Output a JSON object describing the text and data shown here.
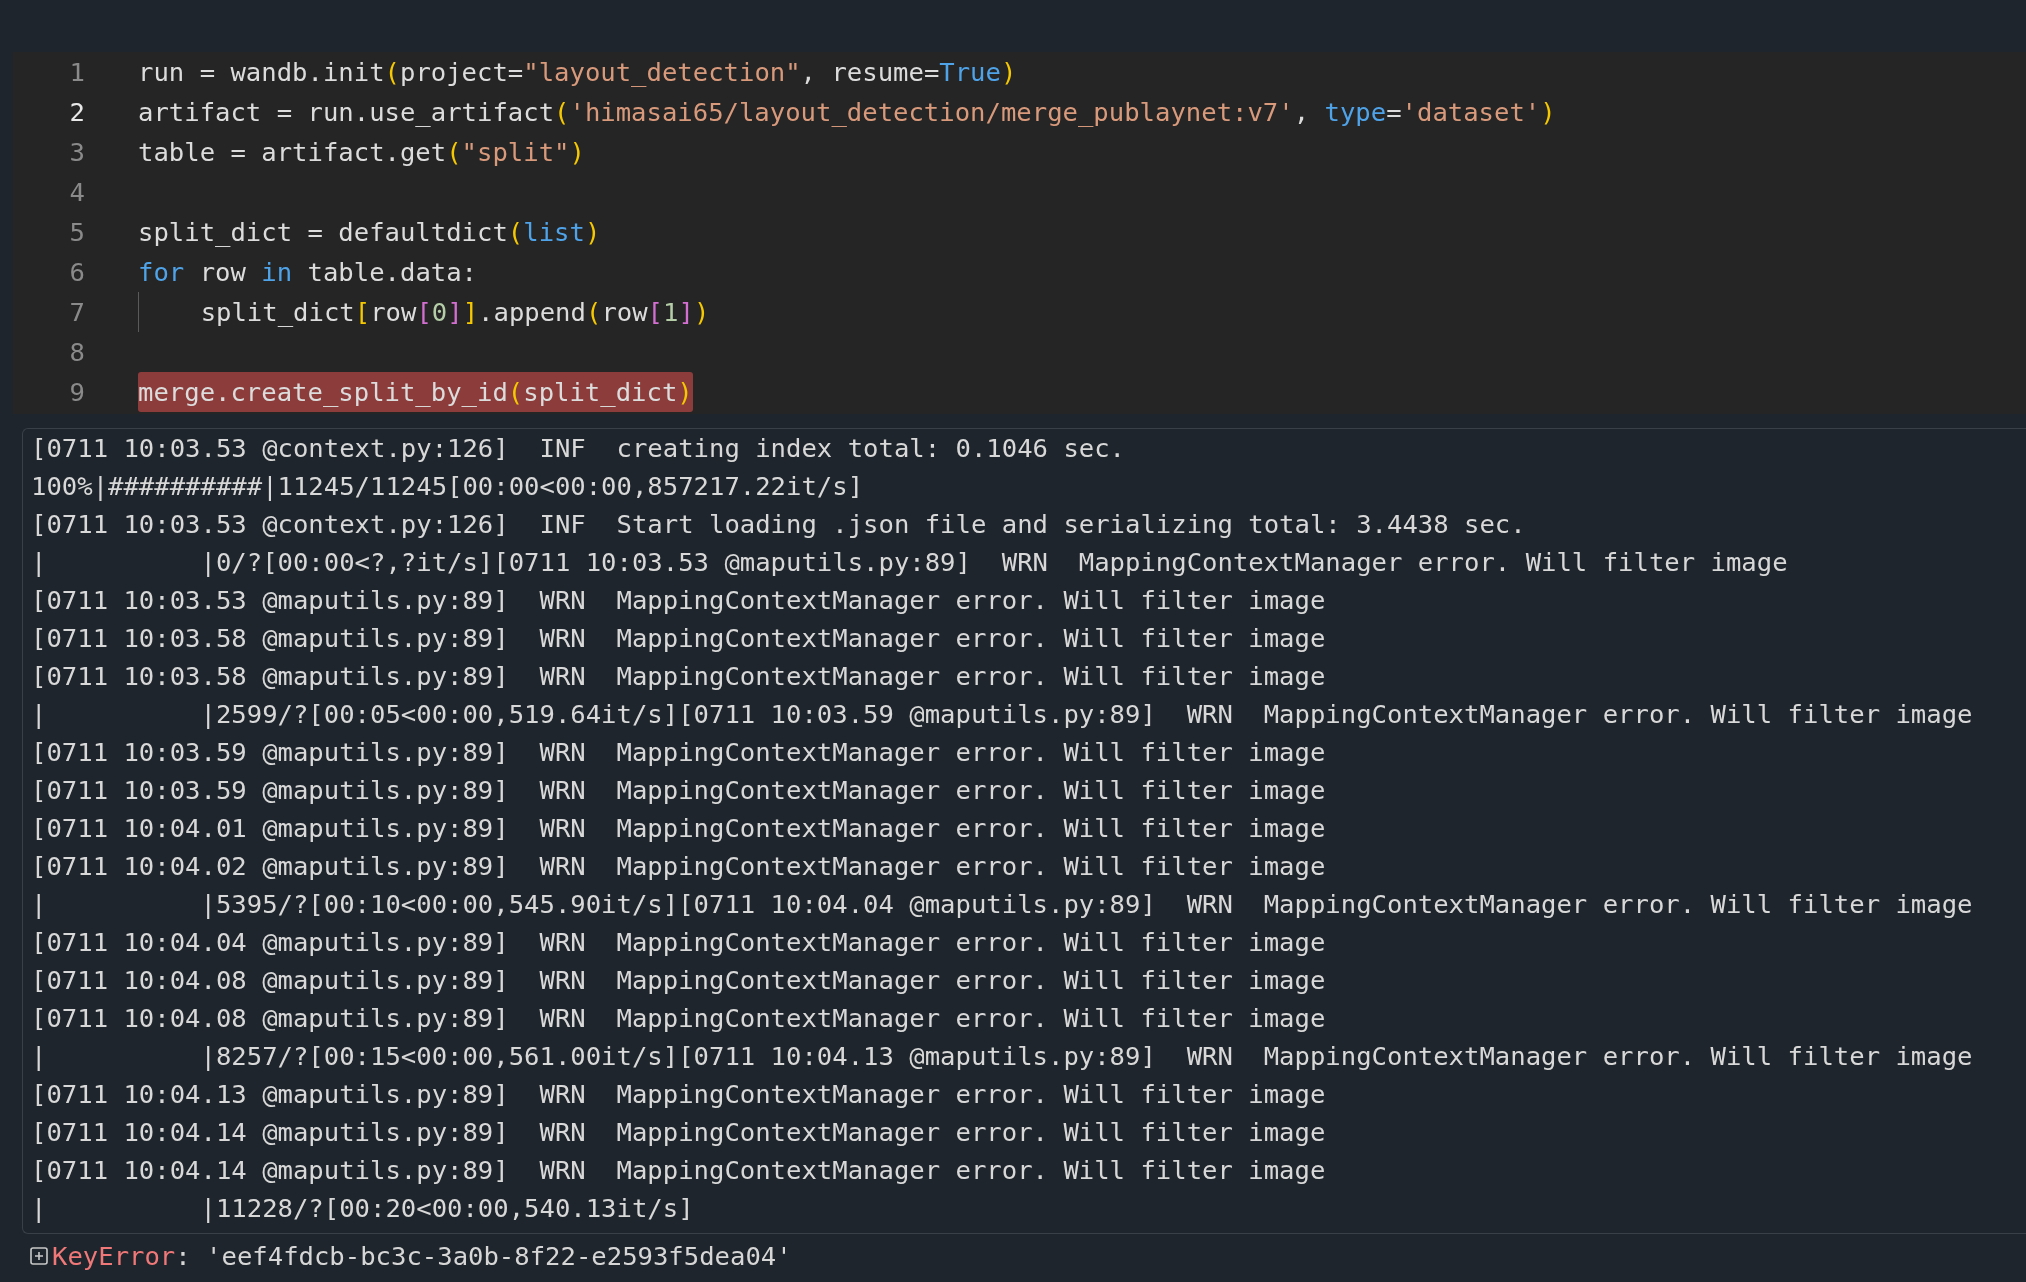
{
  "code_cell": {
    "lines": [
      {
        "number": "1",
        "active": false,
        "error": false,
        "tokens": [
          {
            "kind": "plain",
            "text": "run = wandb.init"
          },
          {
            "kind": "bracket",
            "text": "("
          },
          {
            "kind": "plain",
            "text": "project="
          },
          {
            "kind": "string",
            "text": "\"layout_detection\""
          },
          {
            "kind": "plain",
            "text": ", resume="
          },
          {
            "kind": "keyword",
            "text": "True"
          },
          {
            "kind": "bracket",
            "text": ")"
          }
        ]
      },
      {
        "number": "2",
        "active": true,
        "error": false,
        "tokens": [
          {
            "kind": "plain",
            "text": "artifact = run.use_artifact"
          },
          {
            "kind": "bracket",
            "text": "("
          },
          {
            "kind": "string",
            "text": "'himasai65/layout_detection/merge_publaynet:v7'"
          },
          {
            "kind": "plain",
            "text": ", "
          },
          {
            "kind": "keyword",
            "text": "type"
          },
          {
            "kind": "plain",
            "text": "="
          },
          {
            "kind": "string",
            "text": "'dataset'"
          },
          {
            "kind": "bracket",
            "text": ")"
          }
        ]
      },
      {
        "number": "3",
        "active": false,
        "error": false,
        "tokens": [
          {
            "kind": "plain",
            "text": "table = artifact.get"
          },
          {
            "kind": "bracket",
            "text": "("
          },
          {
            "kind": "string",
            "text": "\"split\""
          },
          {
            "kind": "bracket",
            "text": ")"
          }
        ]
      },
      {
        "number": "4",
        "active": false
      },
      {
        "number": "5",
        "active": false,
        "error": false,
        "tokens": [
          {
            "kind": "plain",
            "text": "split_dict = defaultdict"
          },
          {
            "kind": "bracket",
            "text": "("
          },
          {
            "kind": "keyword",
            "text": "list"
          },
          {
            "kind": "bracket",
            "text": ")"
          }
        ]
      },
      {
        "number": "6",
        "active": false,
        "error": false,
        "tokens": [
          {
            "kind": "keyword",
            "text": "for"
          },
          {
            "kind": "plain",
            "text": " row "
          },
          {
            "kind": "keyword",
            "text": "in"
          },
          {
            "kind": "plain",
            "text": " table.data:"
          }
        ]
      },
      {
        "number": "7",
        "active": false,
        "error": false,
        "indent_guide": true,
        "tokens": [
          {
            "kind": "plain",
            "text": "    split_dict"
          },
          {
            "kind": "bracket",
            "text": "["
          },
          {
            "kind": "plain",
            "text": "row"
          },
          {
            "kind": "bracket2",
            "text": "["
          },
          {
            "kind": "number",
            "text": "0"
          },
          {
            "kind": "bracket2",
            "text": "]"
          },
          {
            "kind": "bracket",
            "text": "]"
          },
          {
            "kind": "plain",
            "text": ".append"
          },
          {
            "kind": "bracket",
            "text": "("
          },
          {
            "kind": "plain",
            "text": "row"
          },
          {
            "kind": "bracket2",
            "text": "["
          },
          {
            "kind": "number",
            "text": "1"
          },
          {
            "kind": "bracket2",
            "text": "]"
          },
          {
            "kind": "bracket",
            "text": ")"
          }
        ]
      },
      {
        "number": "8",
        "active": false
      },
      {
        "number": "9",
        "active": false,
        "error": true,
        "tokens": [
          {
            "kind": "plain",
            "text": "merge.create_split_by_id"
          },
          {
            "kind": "bracket",
            "text": "("
          },
          {
            "kind": "plain",
            "text": "split_dict"
          },
          {
            "kind": "bracket",
            "text": ")"
          }
        ]
      }
    ]
  },
  "output": {
    "lines": [
      "[0711 10:03.53 @context.py:126]  INF  creating index total: 0.1046 sec.",
      "100%|##########|11245/11245[00:00<00:00,857217.22it/s]",
      "[0711 10:03.53 @context.py:126]  INF  Start loading .json file and serializing total: 3.4438 sec.",
      "|          |0/?[00:00<?,?it/s][0711 10:03.53 @maputils.py:89]  WRN  MappingContextManager error. Will filter image",
      "[0711 10:03.53 @maputils.py:89]  WRN  MappingContextManager error. Will filter image",
      "[0711 10:03.58 @maputils.py:89]  WRN  MappingContextManager error. Will filter image",
      "[0711 10:03.58 @maputils.py:89]  WRN  MappingContextManager error. Will filter image",
      "|          |2599/?[00:05<00:00,519.64it/s][0711 10:03.59 @maputils.py:89]  WRN  MappingContextManager error. Will filter image",
      "[0711 10:03.59 @maputils.py:89]  WRN  MappingContextManager error. Will filter image",
      "[0711 10:03.59 @maputils.py:89]  WRN  MappingContextManager error. Will filter image",
      "[0711 10:04.01 @maputils.py:89]  WRN  MappingContextManager error. Will filter image",
      "[0711 10:04.02 @maputils.py:89]  WRN  MappingContextManager error. Will filter image",
      "|          |5395/?[00:10<00:00,545.90it/s][0711 10:04.04 @maputils.py:89]  WRN  MappingContextManager error. Will filter image",
      "[0711 10:04.04 @maputils.py:89]  WRN  MappingContextManager error. Will filter image",
      "[0711 10:04.08 @maputils.py:89]  WRN  MappingContextManager error. Will filter image",
      "[0711 10:04.08 @maputils.py:89]  WRN  MappingContextManager error. Will filter image",
      "|          |8257/?[00:15<00:00,561.00it/s][0711 10:04.13 @maputils.py:89]  WRN  MappingContextManager error. Will filter image",
      "[0711 10:04.13 @maputils.py:89]  WRN  MappingContextManager error. Will filter image",
      "[0711 10:04.14 @maputils.py:89]  WRN  MappingContextManager error. Will filter image",
      "[0711 10:04.14 @maputils.py:89]  WRN  MappingContextManager error. Will filter image",
      "|          |11228/?[00:20<00:00,540.13it/s]"
    ]
  },
  "error": {
    "type": "KeyError",
    "message": ": 'eef4fdcb-bc3c-3a0b-8f22-e2593f5dea04'"
  }
}
